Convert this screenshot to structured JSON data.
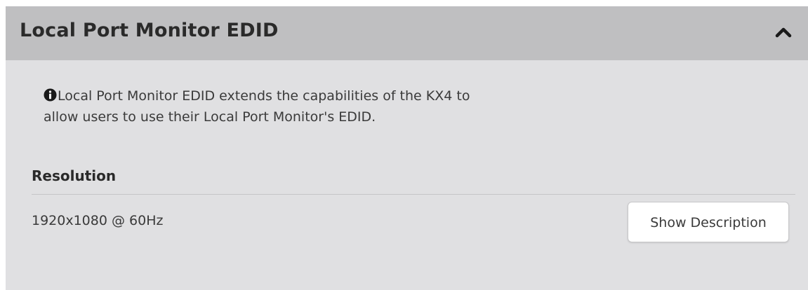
{
  "panel": {
    "title": "Local Port Monitor EDID",
    "collapse_icon": "chevron-up-icon",
    "info": {
      "icon": "info-circle-icon",
      "line1": "Local Port Monitor EDID extends the capabilities of the KX4 to",
      "line2": "allow users to use their Local Port Monitor's EDID."
    },
    "resolution": {
      "label": "Resolution",
      "value": "1920x1080 @ 60Hz",
      "button_label": "Show Description"
    }
  },
  "colors": {
    "header_bg": "#bfbfc1",
    "body_bg": "#e0e0e2",
    "text": "#3a3a3a",
    "title_text": "#2a2a2a"
  }
}
